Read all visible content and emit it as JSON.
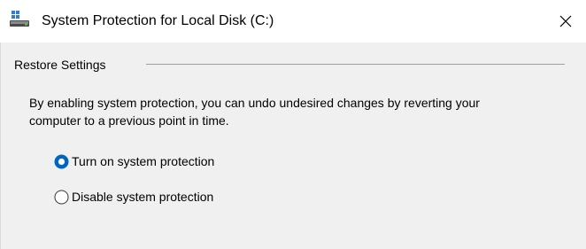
{
  "window": {
    "title": "System Protection for Local Disk (C:)",
    "icon": "system-drive-icon",
    "close_icon": "close-icon"
  },
  "restore_settings": {
    "group_label": "Restore Settings",
    "description": "By enabling system protection, you can undo undesired changes by reverting your computer to a previous point in time.",
    "options": [
      {
        "label": "Turn on system protection",
        "selected": true
      },
      {
        "label": "Disable system protection",
        "selected": false
      }
    ]
  },
  "colors": {
    "accent": "#0067c0",
    "titlebar_bg": "#ffffff",
    "body_bg": "#f0f0f0"
  }
}
